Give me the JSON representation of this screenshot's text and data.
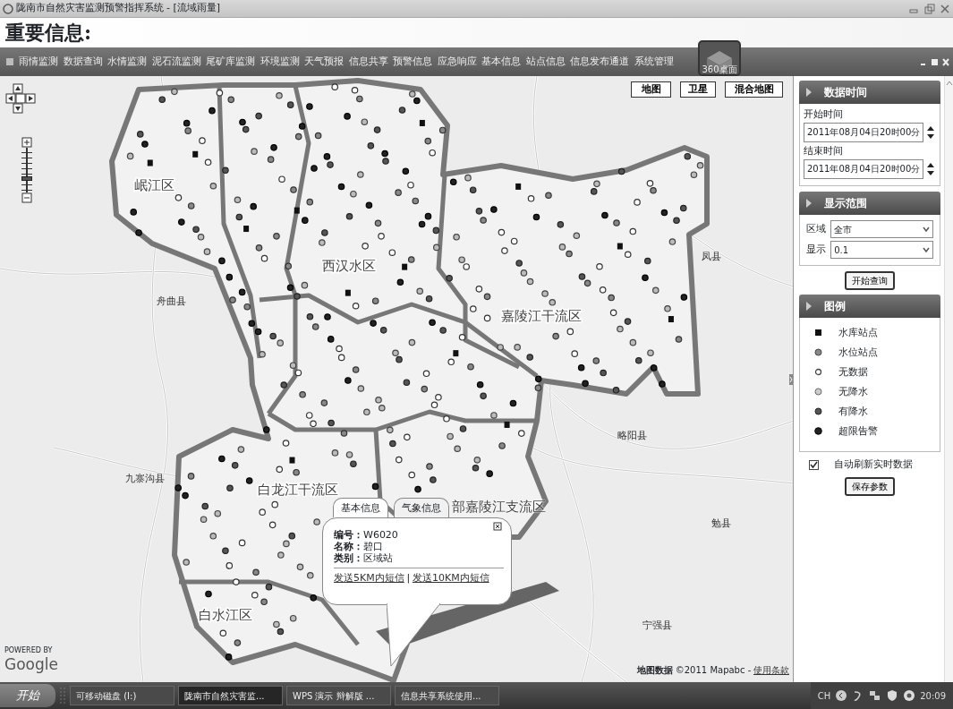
{
  "window": {
    "title": "陇南市自然灾害监测预警指挥系统 - [流域雨量]"
  },
  "header": {
    "title": "重要信息:"
  },
  "menu": {
    "items": [
      {
        "label": "雨情监测"
      },
      {
        "label": "数据查询"
      },
      {
        "label": "水情监测"
      },
      {
        "label": "泥石流监测"
      },
      {
        "label": "尾矿库监测"
      },
      {
        "label": "环境监测"
      },
      {
        "label": "天气预报"
      },
      {
        "label": "信息共享"
      },
      {
        "label": "预警信息"
      },
      {
        "label": "应急响应"
      },
      {
        "label": "基本信息"
      },
      {
        "label": "站点信息"
      },
      {
        "label": "信息发布通道"
      },
      {
        "label": "系统管理"
      }
    ],
    "widget_label": "360桌面"
  },
  "map": {
    "zoom": {
      "level": 0.3
    },
    "type_buttons": [
      {
        "label": "地图"
      },
      {
        "label": "卫星"
      },
      {
        "label": "混合地图"
      }
    ],
    "region_labels": [
      {
        "label": "岷江区"
      },
      {
        "label": "西汉水区"
      },
      {
        "label": "嘉陵江干流区"
      },
      {
        "label": "白龙江干流区"
      },
      {
        "label": "部嘉陵江支流区"
      },
      {
        "label": "白水江区"
      }
    ],
    "place_labels": [
      {
        "label": "舟曲县"
      },
      {
        "label": "九寨沟县"
      },
      {
        "label": "略阳县"
      },
      {
        "label": "凤县"
      },
      {
        "label": "勉县"
      },
      {
        "label": "宁强县"
      }
    ],
    "popup": {
      "tabs": [
        {
          "label": "基本信息",
          "selected": true
        },
        {
          "label": "气象信息",
          "selected": false
        }
      ],
      "fields": [
        {
          "label": "编号：",
          "value": "W6020"
        },
        {
          "label": "名称：",
          "value": "碧口"
        },
        {
          "label": "类别：",
          "value": "区域站"
        }
      ],
      "links": [
        {
          "label": "发送5KM内短信"
        },
        {
          "label": "发送10KM内短信"
        }
      ],
      "separator": "|"
    },
    "logo": {
      "powered": "POWERED BY",
      "name": "Google"
    },
    "attribution": {
      "data": "地图数据",
      "copyright": "©2011 Mapabc -",
      "terms": "使用条款"
    }
  },
  "panel": {
    "time": {
      "title": "数据时间",
      "start_label": "开始时间",
      "start_value": "2011年08月04日20时00分",
      "end_label": "结束时间",
      "end_value": "2011年08月04日20时00分"
    },
    "range": {
      "title": "显示范围",
      "fields": [
        {
          "label": "区域",
          "value": "全市"
        },
        {
          "label": "显示",
          "value": "0.1"
        }
      ]
    },
    "query_button": "开始查询",
    "legend": {
      "title": "图例",
      "items": [
        {
          "kind": "square",
          "label": "水库站点"
        },
        {
          "kind": "gray",
          "label": "水位站点"
        },
        {
          "kind": "ring",
          "label": "无数据"
        },
        {
          "kind": "light",
          "label": "无降水"
        },
        {
          "kind": "dark",
          "label": "有降水"
        },
        {
          "kind": "black",
          "label": "超限告警"
        }
      ]
    },
    "auto_refresh": {
      "label": "自动刷新实时数据",
      "checked": true
    },
    "save_button": "保存参数"
  },
  "taskbar": {
    "start": "开始",
    "items": [
      {
        "label": "可移动磁盘 (I:)",
        "selected": false
      },
      {
        "label": "陇南市自然灾害监...",
        "selected": true
      },
      {
        "label": "WPS 演示 辩解版 ...",
        "selected": false
      },
      {
        "label": "信息共享系统使用...",
        "selected": false
      }
    ],
    "tray_lang": "CH",
    "clock": "20:09"
  }
}
